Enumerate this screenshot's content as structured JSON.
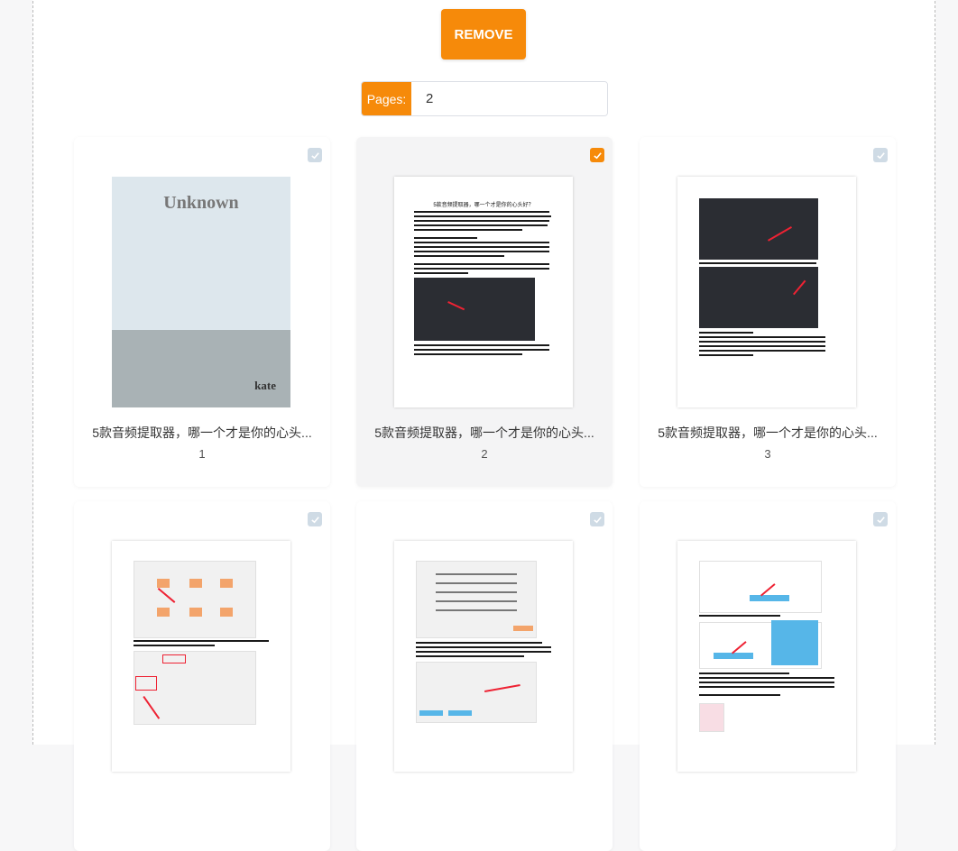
{
  "toolbar": {
    "remove_label": "REMOVE"
  },
  "pages": {
    "label": "Pages:",
    "value": "2"
  },
  "colors": {
    "accent": "#f68a0a",
    "checkbox_off": "#cfdbe5"
  },
  "icons": {
    "checkbox": "checkmark-icon"
  },
  "cards": [
    {
      "title": "5款音频提取器，哪一个才是你的心头...",
      "number": "1",
      "checked": false,
      "cover_title": "Unknown",
      "cover_author": "kate"
    },
    {
      "title": "5款音频提取器，哪一个才是你的心头...",
      "number": "2",
      "checked": true,
      "doc_heading": "5款音频提取器，哪一个才是你的心头好？"
    },
    {
      "title": "5款音频提取器，哪一个才是你的心头...",
      "number": "3",
      "checked": false
    },
    {
      "title": "",
      "number": "",
      "checked": false
    },
    {
      "title": "",
      "number": "",
      "checked": false
    },
    {
      "title": "",
      "number": "",
      "checked": false
    }
  ]
}
